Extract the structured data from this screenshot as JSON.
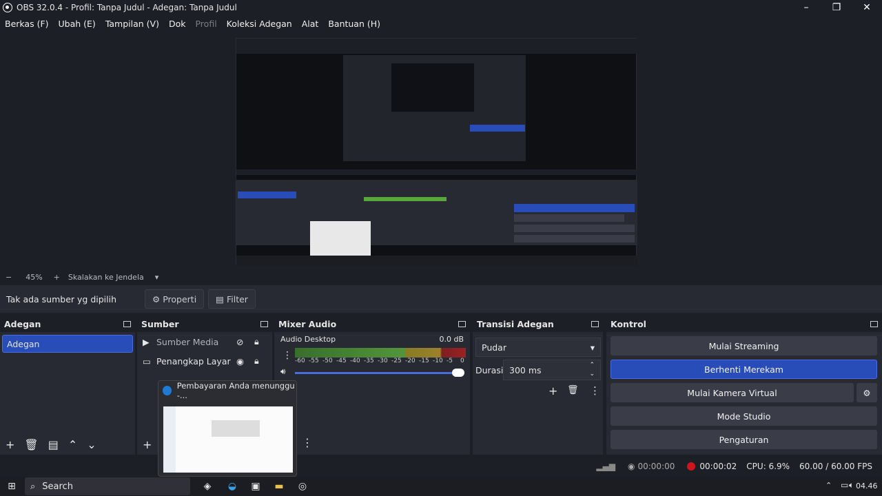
{
  "window": {
    "title": "OBS 32.0.4 - Profil: Tanpa Judul - Adegan: Tanpa Judul"
  },
  "menu": [
    {
      "label": "Berkas (F)",
      "enabled": true
    },
    {
      "label": "Ubah (E)",
      "enabled": true
    },
    {
      "label": "Tampilan (V)",
      "enabled": true
    },
    {
      "label": "Dok",
      "enabled": true
    },
    {
      "label": "Profil",
      "enabled": false
    },
    {
      "label": "Koleksi Adegan",
      "enabled": true
    },
    {
      "label": "Alat",
      "enabled": true
    },
    {
      "label": "Bantuan (H)",
      "enabled": true
    }
  ],
  "zoom": {
    "minus": "−",
    "value": "45%",
    "plus": "+",
    "scale_label": "Skalakan ke Jendela"
  },
  "source_bar": {
    "no_source": "Tak ada sumber yg dipilih",
    "properties": "Properti",
    "filter": "Filter"
  },
  "scenes": {
    "title": "Adegan",
    "items": [
      "Adegan"
    ]
  },
  "sources": {
    "title": "Sumber",
    "items": [
      "Sumber Media",
      "Penangkap Layar"
    ]
  },
  "mixer": {
    "title": "Mixer Audio",
    "track": "Audio Desktop",
    "db": "0.0 dB",
    "scale": [
      "-60",
      "-55",
      "-50",
      "-45",
      "-40",
      "-35",
      "-30",
      "-25",
      "-20",
      "-15",
      "-10",
      "-5",
      "0"
    ],
    "volume": 1.0
  },
  "transitions": {
    "title": "Transisi Adegan",
    "selected": "Pudar",
    "duration_label": "Durasi",
    "duration_value": "300 ms"
  },
  "controls": {
    "title": "Kontrol",
    "start_streaming": "Mulai Streaming",
    "stop_recording": "Berhenti Merekam",
    "start_virtual_cam": "Mulai Kamera Virtual",
    "studio_mode": "Mode Studio",
    "settings": "Pengaturan"
  },
  "status": {
    "stream_time": "00:00:00",
    "rec_time": "00:00:02",
    "cpu": "CPU: 6.9%",
    "fps": "60.00 / 60.00 FPS"
  },
  "popup": {
    "title": "Pembayaran Anda menunggu -..."
  },
  "taskbar": {
    "search": "Search",
    "time": "04.46"
  },
  "colors": {
    "accent": "#284cb8",
    "bg": "#1d1f26",
    "panel": "#272a33",
    "record": "#d0141c"
  }
}
